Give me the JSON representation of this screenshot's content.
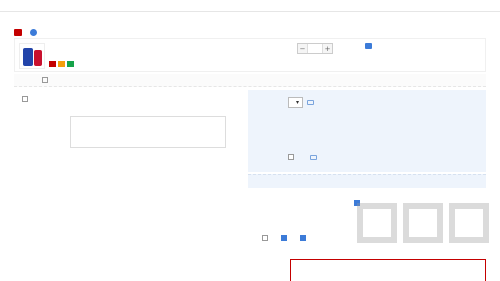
{
  "header": {
    "col_info": "",
    "col_attr": "",
    "col_price": "",
    "col_qty": "",
    "col_promo": "",
    "col_subtotal": ""
  },
  "shop": {
    "name": ""
  },
  "item": {
    "title_hot": "",
    "title": "",
    "sku": "",
    "price": "",
    "qty": "",
    "promo": "",
    "subtotal": ""
  },
  "welfare": {
    "label": "",
    "desc": "",
    "price": "",
    "qty": "",
    "subtotal": ""
  },
  "invoice": {
    "label": ""
  },
  "memo": {
    "label": "",
    "placeholder": "",
    "counter": ""
  },
  "coupon": {
    "label": "",
    "selected": "",
    "value": ""
  },
  "shipping": {
    "label": "",
    "text": "",
    "value": ""
  },
  "insurance": {
    "label": "",
    "badge": "",
    "text": "",
    "value": ""
  },
  "shop_total": {
    "label": "",
    "amount": ""
  },
  "float_tag": "",
  "options": {
    "anon": "",
    "addr_confirm": "",
    "third": ""
  },
  "pay": {
    "label": "",
    "currency": "",
    "amount": ""
  },
  "watermark": ""
}
